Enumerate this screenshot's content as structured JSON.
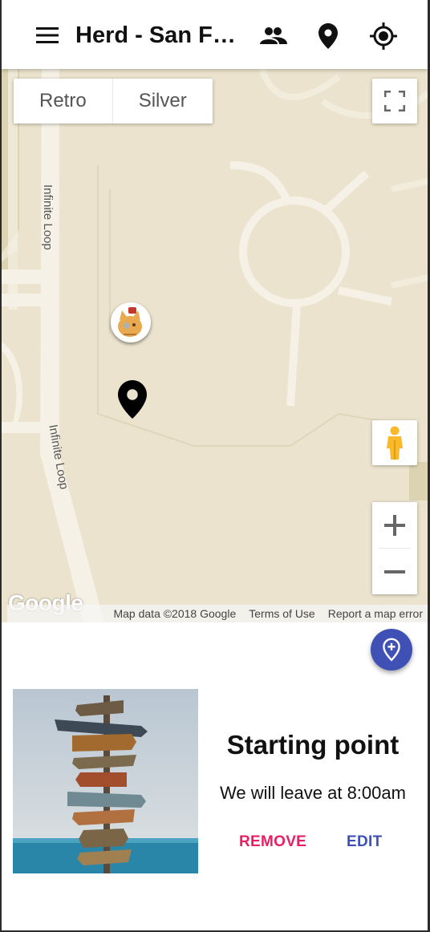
{
  "appbar": {
    "title": "Herd - San Francisco",
    "icons": [
      "menu-icon",
      "people-icon",
      "place-icon",
      "my-location-icon"
    ]
  },
  "map": {
    "map_type_buttons": [
      "Retro",
      "Silver"
    ],
    "road_labels": [
      "Infinite Loop",
      "Infinite Loop"
    ],
    "google_logo": "Google",
    "attribution": {
      "map_data": "Map data ©2018 Google",
      "terms": "Terms of Use",
      "report": "Report a map error"
    },
    "zoom_in": "+",
    "zoom_out": "−"
  },
  "card": {
    "title": "Starting point",
    "subtitle": "We will leave at 8:00am",
    "remove_label": "REMOVE",
    "edit_label": "EDIT"
  },
  "colors": {
    "primary": "#3f51b5",
    "accent": "#e91e63",
    "map_bg": "#ebe3cd"
  }
}
